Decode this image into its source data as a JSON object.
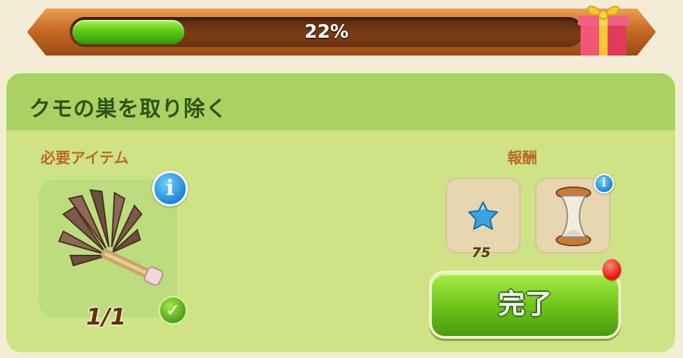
{
  "progress": {
    "percent_label": "22%",
    "fraction": 0.22
  },
  "icons": {
    "gift": "gift-box-icon",
    "info": "i",
    "check": "✓",
    "gem": "blue-star-gem-icon",
    "hourglass": "hourglass-icon",
    "duster": "feather-duster-icon"
  },
  "task": {
    "title": "クモの巣を取り除く",
    "required_label": "必要アイテム",
    "item_count": "1/1",
    "reward_label": "報酬",
    "reward_amount": "75",
    "complete_label": "完了"
  },
  "colors": {
    "progress_fill": "#5ecb19",
    "panel": "#cfe285",
    "panel_header": "#a9d262",
    "button": "#6bc31b",
    "label_text": "#b86a2a",
    "info_blue": "#1e86d4",
    "alert_red": "#e51a0f"
  }
}
